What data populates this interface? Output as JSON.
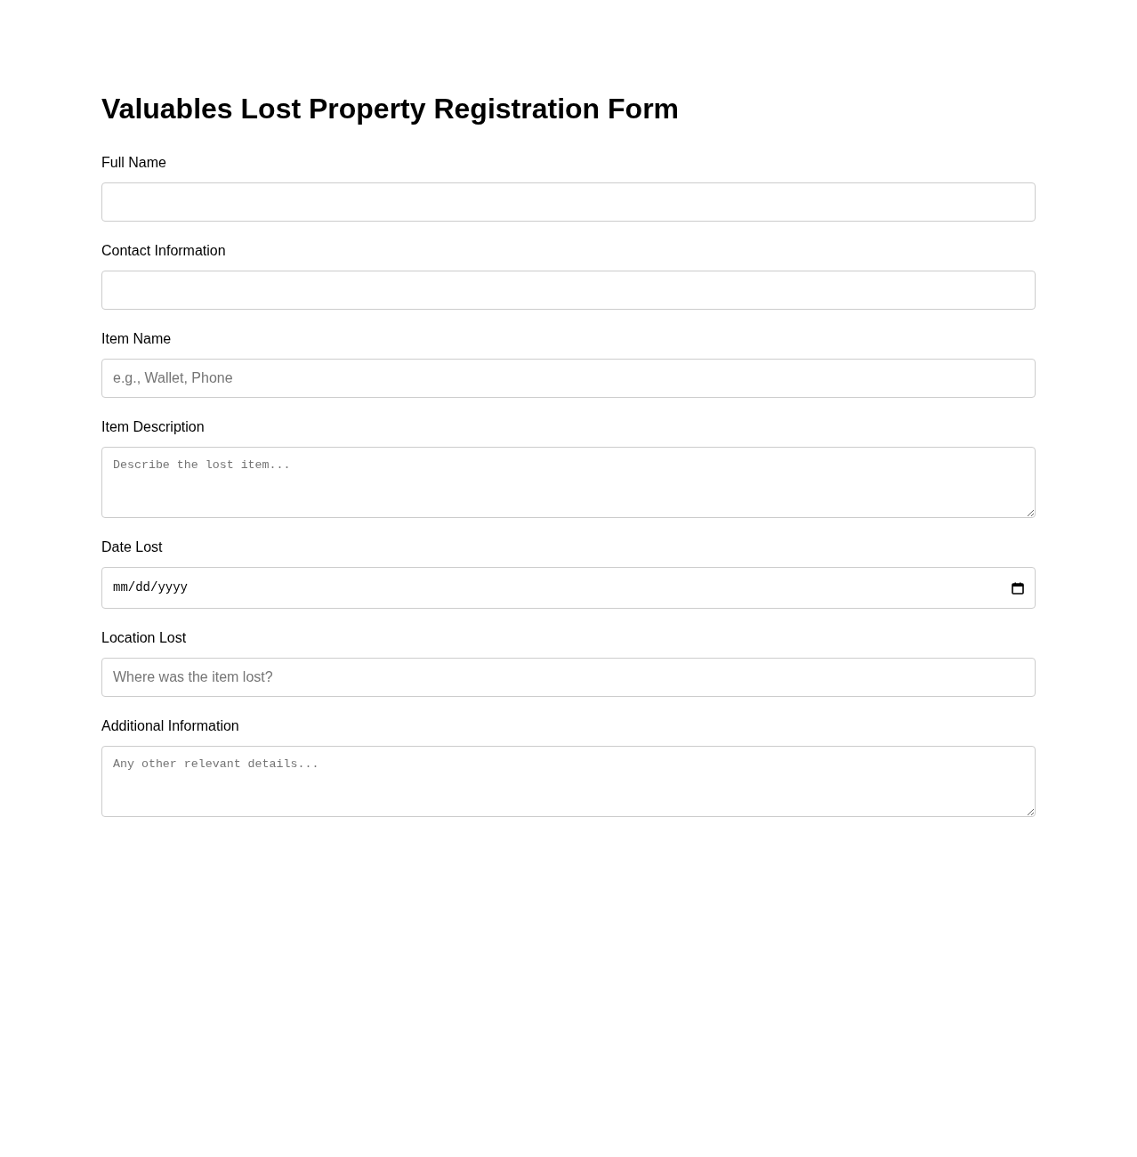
{
  "title": "Valuables Lost Property Registration Form",
  "fields": [
    {
      "label": "Full Name",
      "kind": "text"
    },
    {
      "label": "Contact Information",
      "kind": "text"
    },
    {
      "label": "Item Name",
      "kind": "text",
      "placeholder": "e.g., Wallet, Phone"
    },
    {
      "label": "Item Description",
      "kind": "textarea",
      "placeholder": "Describe the lost item..."
    },
    {
      "label": "Date Lost",
      "kind": "date",
      "value": "mm/dd/yyyy"
    },
    {
      "label": "Location Lost",
      "kind": "text",
      "placeholder": "Where was the item lost?"
    },
    {
      "label": "Additional Information",
      "kind": "textarea",
      "placeholder": "Any other relevant details..."
    }
  ]
}
